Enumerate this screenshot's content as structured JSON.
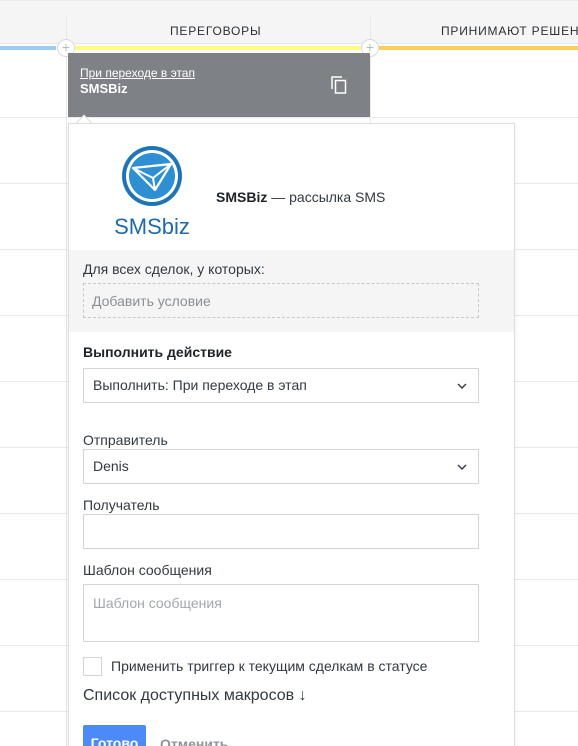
{
  "board": {
    "columns": [
      {
        "title": ""
      },
      {
        "title": "ПЕРЕГОВОРЫ"
      },
      {
        "title": "ПРИНИМАЮТ РЕШЕН"
      }
    ],
    "colors": {
      "stage_left": "#99ccee",
      "stage_middle": "#fffd7f",
      "stage_right": "#ffce5a"
    }
  },
  "trigger_card": {
    "link_text": "При переходе в этап",
    "name": "SMSBiz",
    "copy_icon": "copy-icon"
  },
  "popup": {
    "logo_text": "SMSbiz",
    "widget_name": "SMSBiz",
    "widget_desc": " — рассылка SMS",
    "condition": {
      "label": "Для всех сделок, у которых:",
      "placeholder": "Добавить условие"
    },
    "action": {
      "label": "Выполнить действие",
      "value": "Выполнить: При переходе в этап"
    },
    "sender": {
      "label": "Отправитель",
      "value": "Denis"
    },
    "recipient": {
      "label": "Получатель",
      "value": ""
    },
    "template": {
      "label": "Шаблон сообщения",
      "placeholder": "Шаблон сообщения"
    },
    "apply_checkbox_label": "Применить триггер к текущим сделкам в статусе",
    "macros_label": "Список доступных макросов ↓",
    "buttons": {
      "done": "Готово",
      "cancel": "Отменить"
    },
    "colors": {
      "primary": "#4c8bf7",
      "logo_blue": "#1f74b8"
    }
  }
}
